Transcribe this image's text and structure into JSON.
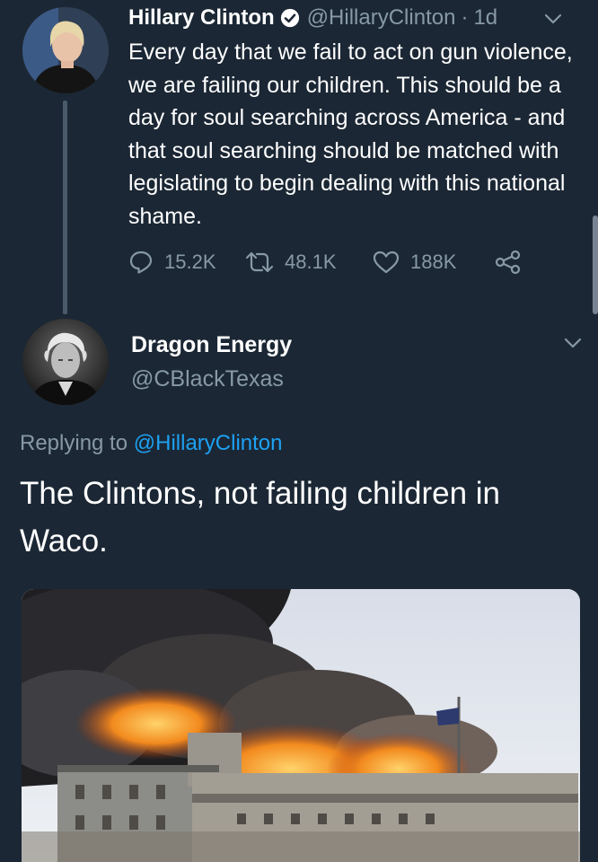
{
  "tweet1": {
    "name": "Hillary Clinton",
    "handle": "@HillaryClinton",
    "separator": "·",
    "time": "1d",
    "text": "Every day that we fail to act on gun violence, we are failing our children. This should be a day for soul searching across America - and that soul searching should be matched with legislating to begin dealing with this national shame.",
    "replies": "15.2K",
    "retweets": "48.1K",
    "likes": "188K"
  },
  "tweet2": {
    "name": "Dragon Energy",
    "handle": "@CBlackTexas",
    "replying_prefix": "Replying to",
    "replying_to": "@HillaryClinton",
    "text": "The Clintons, not failing children in Waco."
  },
  "colors": {
    "background": "#1b2734",
    "muted": "#8899a6",
    "link": "#1da1f2",
    "thread_line": "#495a6b"
  },
  "icons": [
    "verified-badge-icon",
    "chevron-down-icon",
    "reply-icon",
    "retweet-icon",
    "like-icon",
    "share-icon"
  ]
}
